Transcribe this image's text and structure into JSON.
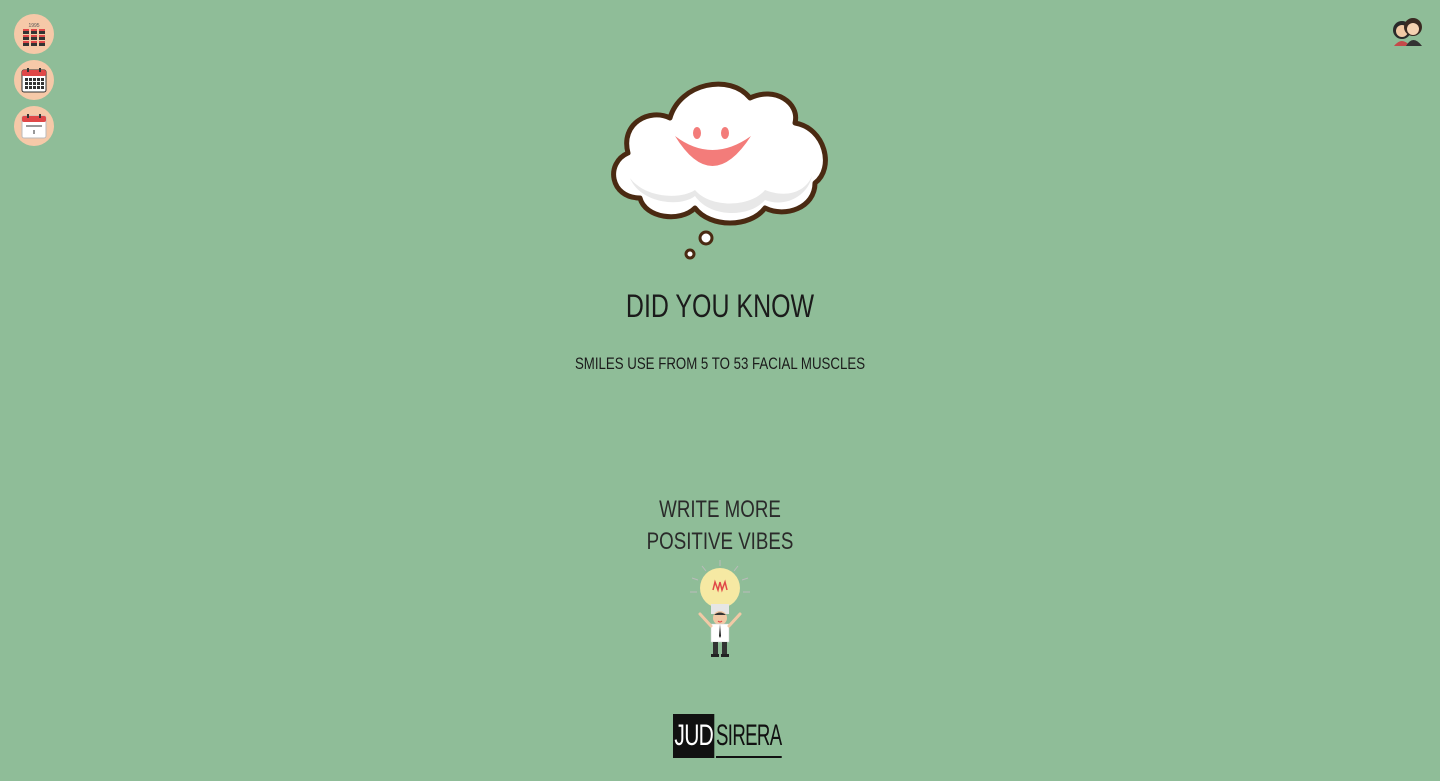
{
  "nav": {
    "items": [
      {
        "name": "year-view",
        "icon": "year-calendar-icon"
      },
      {
        "name": "month-view",
        "icon": "month-calendar-icon"
      },
      {
        "name": "day-view",
        "icon": "day-calendar-icon"
      }
    ]
  },
  "profile": {
    "icon": "couple-avatar-icon"
  },
  "tip": {
    "headline": "DID YOU KNOW",
    "fact": "SMILES USE FROM 5 TO 53 FACIAL MUSCLES"
  },
  "cta": {
    "line1": "WRITE MORE",
    "line2": "POSITIVE VIBES",
    "icon": "lightbulb-man-icon"
  },
  "brand": {
    "part1": "JUD",
    "part2": "SIRERA"
  },
  "colors": {
    "background": "#8fbd98",
    "nav_button": "#f6c9a8",
    "smile": "#f37c7a",
    "cloud_outline": "#4a2a12"
  }
}
